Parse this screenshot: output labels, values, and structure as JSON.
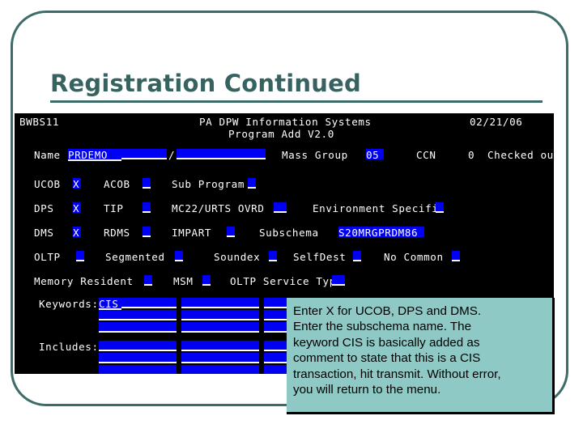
{
  "slide": {
    "title": "Registration Continued",
    "accent_color": "#3d6b68",
    "title_color": "#36625f",
    "background_color": "#ffffff"
  },
  "terminal": {
    "background_color": "#000000",
    "text_color": "#ffffff",
    "field_color": "#0000f2",
    "header": {
      "screen_id": "BWBS11",
      "system_title": "PA DPW Information Systems",
      "program_title": "Program Add V2.0",
      "date": "02/21/06"
    },
    "name_row": {
      "name_label": "Name",
      "name_value": "PRDEMO",
      "separator": "/",
      "mass_group_label": "Mass Group",
      "mass_group_value": "05",
      "ccn_label": "CCN",
      "ccn_value": "0",
      "checked_out_label": "Checked out"
    },
    "flags": [
      {
        "label": "UCOB",
        "value": "X"
      },
      {
        "label": "ACOB",
        "value": ""
      },
      {
        "label": "Sub Program",
        "value": ""
      },
      {
        "label": "DPS",
        "value": "X"
      },
      {
        "label": "TIP",
        "value": ""
      },
      {
        "label": "MC22/URTS OVRD",
        "value": ""
      },
      {
        "label": "Environment Specific",
        "value": ""
      },
      {
        "label": "DMS",
        "value": "X"
      },
      {
        "label": "RDMS",
        "value": ""
      },
      {
        "label": "IMPART",
        "value": ""
      },
      {
        "label": "Subschema",
        "value": "S20MRGPRDM86"
      },
      {
        "label": "OLTP",
        "value": ""
      },
      {
        "label": "Segmented",
        "value": ""
      },
      {
        "label": "Soundex",
        "value": ""
      },
      {
        "label": "SelfDest",
        "value": ""
      },
      {
        "label": "No Common",
        "value": ""
      },
      {
        "label": "Memory Resident",
        "value": ""
      },
      {
        "label": "MSM",
        "value": ""
      },
      {
        "label": "OLTP Service Type",
        "value": ""
      }
    ],
    "keywords": {
      "label": "Keywords:",
      "first_value": "CIS"
    },
    "includes": {
      "label": "Includes:"
    }
  },
  "callout": {
    "background_color": "#8fc9c6",
    "lines": [
      "Enter  X for UCOB, DPS and DMS.",
      "Enter the subschema name.  The",
      "keyword CIS is basically added as",
      "comment to state that this is a CIS",
      "transaction, hit transmit.  Without error,",
      "you will return to the menu."
    ]
  }
}
